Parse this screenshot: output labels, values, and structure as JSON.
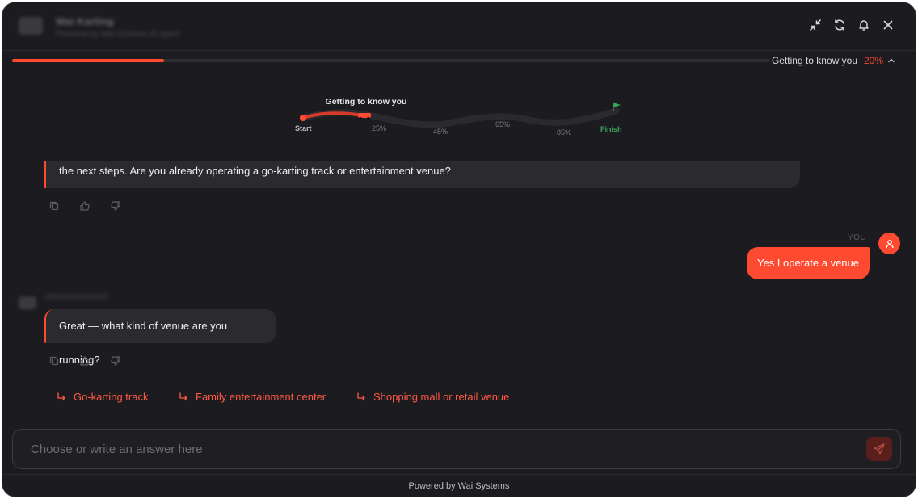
{
  "header": {
    "brand_title": "Wai Karting",
    "brand_subtitle": "Powered by Wai Systems AI agent",
    "icons": [
      "collapse-icon",
      "refresh-icon",
      "bell-icon",
      "close-icon"
    ]
  },
  "progress": {
    "label": "Getting to know you",
    "percent_text": "20%",
    "value": 0.2
  },
  "journey": {
    "title": "Getting to know you",
    "start": "Start",
    "milestones": [
      "25%",
      "45%",
      "65%",
      "85%"
    ],
    "finish": "Finish"
  },
  "messages": {
    "bot_1": "the next steps. Are you already operating a go-karting track or entertainment venue?",
    "you_tag": "YOU",
    "user_1": "Yes I operate a venue",
    "bot_2": "Great — what kind of venue are you running?"
  },
  "suggestions": [
    "Go-karting track",
    "Family entertainment center",
    "Shopping mall or retail venue"
  ],
  "composer": {
    "placeholder": "Choose or write an answer here"
  },
  "footer": {
    "text": "Powered by Wai Systems"
  },
  "colors": {
    "accent": "#ff4a32",
    "background": "#1c1b1f",
    "finish_green": "#3aa756"
  }
}
